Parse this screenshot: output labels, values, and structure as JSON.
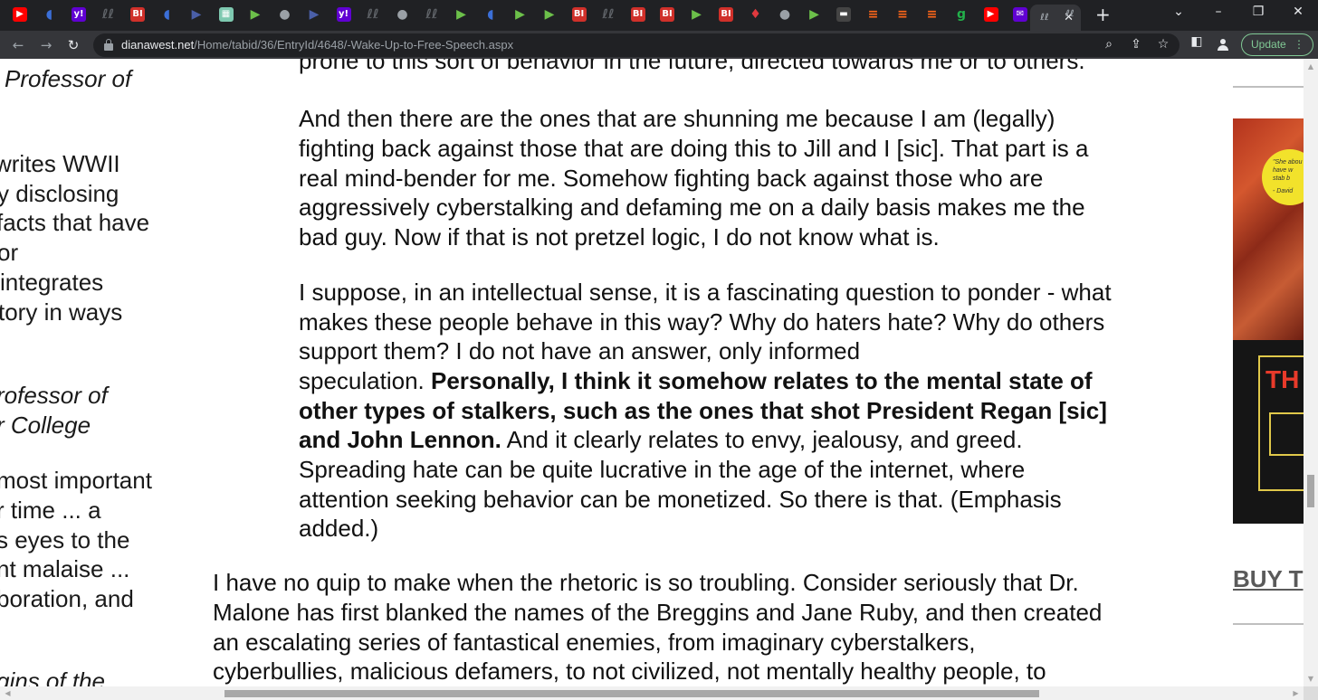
{
  "browser": {
    "tabs": [
      {
        "icon": "youtube-icon",
        "glyph": "▶",
        "color": "#ff0000"
      },
      {
        "icon": "shield-icon",
        "glyph": "◖",
        "color": "#3b6fd8"
      },
      {
        "icon": "yahoo-icon",
        "glyph": "y!",
        "color": "#6001d2"
      },
      {
        "icon": "site-glyph-icon",
        "glyph": "ℓℓ",
        "color": "#5f6368"
      },
      {
        "icon": "bi-icon",
        "glyph": "BI",
        "color": "#d0302a"
      },
      {
        "icon": "shield-icon",
        "glyph": "◖",
        "color": "#3b6fd8"
      },
      {
        "icon": "play-arrow-icon",
        "glyph": "▶",
        "color": "#4a5fa8"
      },
      {
        "icon": "grid-icon",
        "glyph": "▦",
        "color": "#7ec9b0"
      },
      {
        "icon": "rumble-icon",
        "glyph": "▶",
        "color": "#6cc04a"
      },
      {
        "icon": "globe-icon",
        "glyph": "●",
        "color": "#9aa0a6"
      },
      {
        "icon": "play-arrow-icon",
        "glyph": "▶",
        "color": "#4a5fa8"
      },
      {
        "icon": "yahoo-icon",
        "glyph": "y!",
        "color": "#6001d2"
      },
      {
        "icon": "site-glyph-icon",
        "glyph": "ℓℓ",
        "color": "#5f6368"
      },
      {
        "icon": "globe-icon",
        "glyph": "●",
        "color": "#9aa0a6"
      },
      {
        "icon": "site-glyph-icon",
        "glyph": "ℓℓ",
        "color": "#5f6368"
      },
      {
        "icon": "rumble-icon",
        "glyph": "▶",
        "color": "#6cc04a"
      },
      {
        "icon": "shield-icon",
        "glyph": "◖",
        "color": "#3b6fd8"
      },
      {
        "icon": "rumble-icon",
        "glyph": "▶",
        "color": "#6cc04a"
      },
      {
        "icon": "rumble-icon",
        "glyph": "▶",
        "color": "#6cc04a"
      },
      {
        "icon": "bi-icon",
        "glyph": "BI",
        "color": "#d0302a"
      },
      {
        "icon": "site-glyph-icon",
        "glyph": "ℓℓ",
        "color": "#5f6368"
      },
      {
        "icon": "bi-icon",
        "glyph": "BI",
        "color": "#d0302a"
      },
      {
        "icon": "bi-icon",
        "glyph": "BI",
        "color": "#d0302a"
      },
      {
        "icon": "rumble-icon",
        "glyph": "▶",
        "color": "#6cc04a"
      },
      {
        "icon": "bi-icon",
        "glyph": "BI",
        "color": "#d0302a"
      },
      {
        "icon": "microphone-icon",
        "glyph": "♦",
        "color": "#e0393e"
      },
      {
        "icon": "globe-icon",
        "glyph": "●",
        "color": "#9aa0a6"
      },
      {
        "icon": "rumble-icon",
        "glyph": "▶",
        "color": "#6cc04a"
      },
      {
        "icon": "news-icon",
        "glyph": "▬",
        "color": "#444444"
      },
      {
        "icon": "substack-icon",
        "glyph": "≡",
        "color": "#ff6719"
      },
      {
        "icon": "substack-icon",
        "glyph": "≡",
        "color": "#ff6719"
      },
      {
        "icon": "substack-icon",
        "glyph": "≡",
        "color": "#ff6719"
      },
      {
        "icon": "gettr-icon",
        "glyph": "g",
        "color": "#22b04a"
      },
      {
        "icon": "youtube-icon",
        "glyph": "▶",
        "color": "#ff0000"
      },
      {
        "icon": "mail-icon",
        "glyph": "✉",
        "color": "#6001d2"
      }
    ],
    "active_tab": {
      "icon": "site-glyph-icon",
      "glyph": "ℓℓ",
      "close": "✕"
    },
    "url_host": "dianawest.net",
    "url_path": "/Home/tabid/36/EntryId/4648/-Wake-Up-to-Free-Speech.aspx",
    "update_label": "Update"
  },
  "left_sidebar": {
    "lines": [
      "Professor of",
      "writes WWII",
      "y disclosing",
      "facts that have",
      "or",
      "integrates",
      "tory in ways",
      "rofessor of",
      "r College",
      "most important",
      "r time ... a",
      "s eyes to the",
      "nt malaise ...",
      "boration, and",
      "gins of the"
    ]
  },
  "article": {
    "cut_line": "prone to this sort of behavior in the future, directed towards me or to others.",
    "para1": [
      "And then there are the ones that are shunning me because I am (legally)",
      "fighting back against those that are doing this to Jill and I [sic]. That part is a",
      "real mind-bender for me. Somehow fighting back against those who are",
      "aggressively cyberstalking and defaming me on a daily basis makes me the",
      "bad guy. Now if that is not pretzel logic, I do not know what is."
    ],
    "para2": [
      "I suppose, in an intellectual sense, it is a fascinating question to ponder - what",
      "makes these people behave in this way? Why do haters hate? Why do others",
      "support them? I do not have an answer, only informed"
    ],
    "para2_mixed_a_plain": "speculation. ",
    "para2_mixed_a_bold": "Personally, I think it somehow relates to the mental state of",
    "para2_bold_b": "other types of stalkers, such as the ones that shot President Regan [sic]",
    "para2_mixed_c_bold": "and John Lennon.",
    "para2_mixed_c_plain": " And it clearly relates to envy, jealousy, and greed.",
    "para2_tail": [
      "Spreading hate can be quite lucrative in the age of the internet, where",
      "attention seeking behavior can be monetized. So there is that. (Emphasis",
      "added.)"
    ],
    "body": [
      "I have no quip to make when the rhetoric is so troubling. Consider seriously that Dr.",
      "Malone has first blanked the names of the Breggins and Jane Ruby, and then created",
      "an escalating series of fantastical enemies, from imaginary cyberstalkers,",
      "cyberbullies, malicious defamers, to not civilized, not mentally healthy people, to"
    ]
  },
  "right_sidebar": {
    "book_title_fragment": "TH",
    "sticker_text": [
      "\"She abou",
      "have w",
      "stab b",
      "- David"
    ],
    "buy_text": "BUY T"
  }
}
